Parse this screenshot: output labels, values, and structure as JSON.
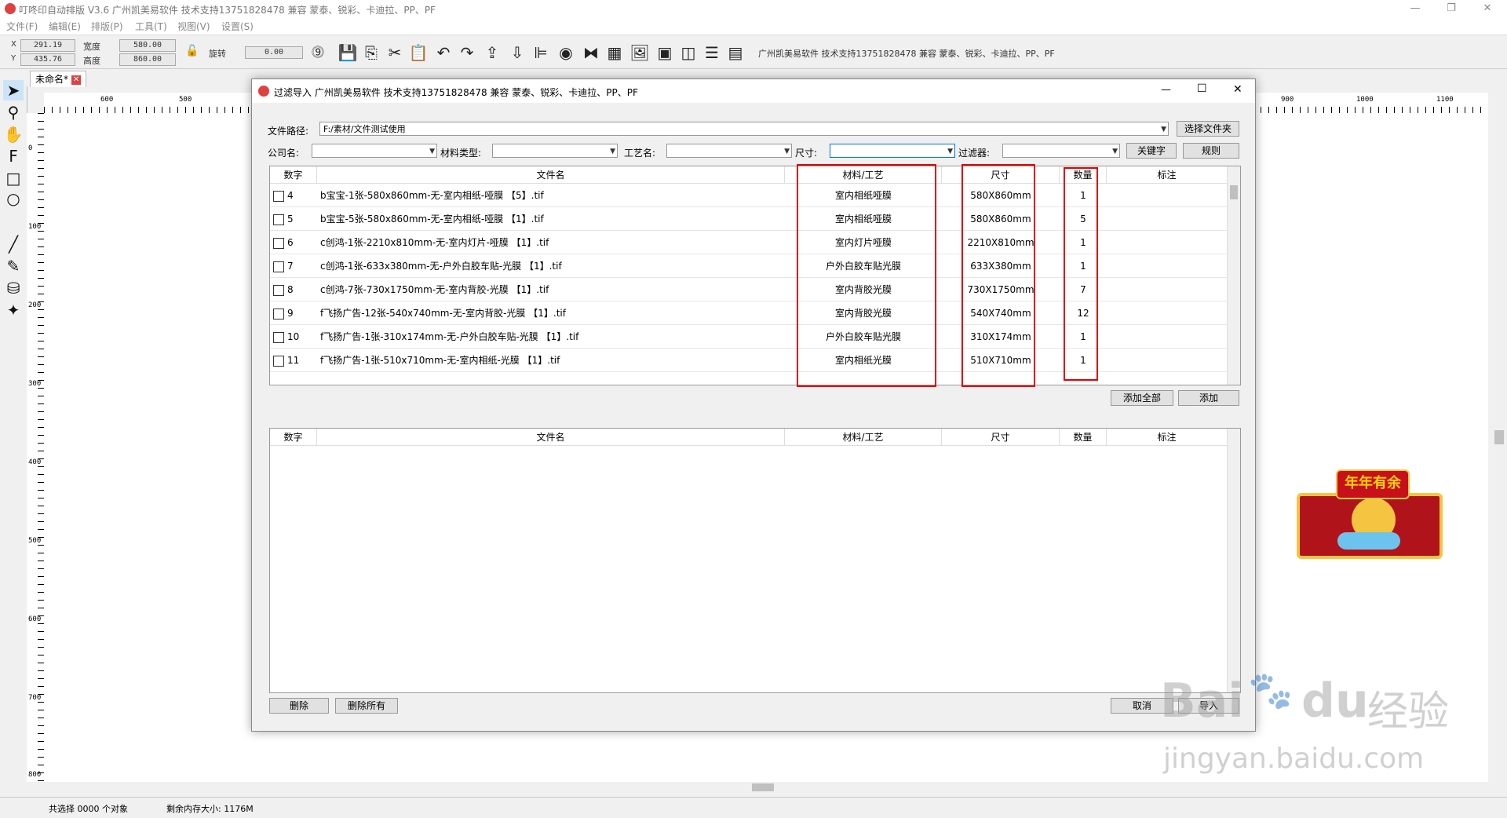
{
  "app": {
    "title": "叮咚印自动排版 V3.6 广州凯美易软件 技术支持13751828478 兼容 蒙泰、锐彩、卡迪拉、PP、PF"
  },
  "menu": [
    "文件(F)",
    "编辑(E)",
    "排版(P)",
    "工具(T)",
    "视图(V)",
    "设置(S)"
  ],
  "toolbar": {
    "x_label": "X",
    "x_value": "291.19",
    "y_label": "Y",
    "y_value": "435.76",
    "width_label": "宽度",
    "width_value": "580.00",
    "height_label": "高度",
    "height_value": "860.00",
    "rotate_label": "旋转",
    "rotate_value": "0.00",
    "vendor_text": "广州凯美易软件 技术支持13751828478 兼容 蒙泰、锐彩、卡迪拉、PP、PF"
  },
  "doc_tab": "未命名*",
  "ruler": {
    "h": [
      "600",
      "500",
      "900",
      "1000",
      "1100"
    ],
    "v": [
      "0",
      "100",
      "200",
      "300",
      "400",
      "500",
      "600",
      "700",
      "800"
    ]
  },
  "status": {
    "selected": "共选择 0000 个对象",
    "memory": "剩余内存大小: 1176M"
  },
  "dialog": {
    "title": "过滤导入 广州凯美易软件 技术支持13751828478 兼容 蒙泰、锐彩、卡迪拉、PP、PF",
    "path_label": "文件路径:",
    "path_value": "F:/素材/文件测试使用",
    "choose_folder": "选择文件夹",
    "company_label": "公司名:",
    "material_label": "材料类型:",
    "craft_label": "工艺名:",
    "size_label": "尺寸:",
    "filter_label": "过滤器:",
    "keyword_btn": "关键字",
    "rules_btn": "规则",
    "columns": [
      "数字",
      "文件名",
      "材料/工艺",
      "尺寸",
      "数量",
      "标注"
    ],
    "rows": [
      {
        "num": "4",
        "name": "b宝宝-1张-580x860mm-无-室内相纸-哑膜 【5】.tif",
        "material": "室内相纸哑膜",
        "size": "580X860mm",
        "qty": "1"
      },
      {
        "num": "5",
        "name": "b宝宝-5张-580x860mm-无-室内相纸-哑膜 【1】.tif",
        "material": "室内相纸哑膜",
        "size": "580X860mm",
        "qty": "5"
      },
      {
        "num": "6",
        "name": "c创鸿-1张-2210x810mm-无-室内灯片-哑膜 【1】.tif",
        "material": "室内灯片哑膜",
        "size": "2210X810mm",
        "qty": "1"
      },
      {
        "num": "7",
        "name": "c创鸿-1张-633x380mm-无-户外白胶车贴-光膜 【1】.tif",
        "material": "户外白胶车贴光膜",
        "size": "633X380mm",
        "qty": "1"
      },
      {
        "num": "8",
        "name": "c创鸿-7张-730x1750mm-无-室内背胶-光膜 【1】.tif",
        "material": "室内背胶光膜",
        "size": "730X1750mm",
        "qty": "7"
      },
      {
        "num": "9",
        "name": "f飞扬广告-12张-540x740mm-无-室内背胶-光膜 【1】.tif",
        "material": "室内背胶光膜",
        "size": "540X740mm",
        "qty": "12"
      },
      {
        "num": "10",
        "name": "f飞扬广告-1张-310x174mm-无-户外白胶车贴-光膜 【1】.tif",
        "material": "户外白胶车贴光膜",
        "size": "310X174mm",
        "qty": "1"
      },
      {
        "num": "11",
        "name": "f飞扬广告-1张-510x710mm-无-室内相纸-光膜 【1】.tif",
        "material": "室内相纸光膜",
        "size": "510X710mm",
        "qty": "1"
      }
    ],
    "add_all": "添加全部",
    "add": "添加",
    "delete": "删除",
    "delete_all": "删除所有",
    "cancel": "取消",
    "import": "导入"
  },
  "watermark": {
    "line1": "Bai",
    "line1b": "du",
    "line1c": "经验",
    "line2": "jingyan.baidu.com"
  },
  "sticker_text": "年年有余",
  "colors": {
    "highlight": "#e00000",
    "accent": "#0078d7"
  }
}
